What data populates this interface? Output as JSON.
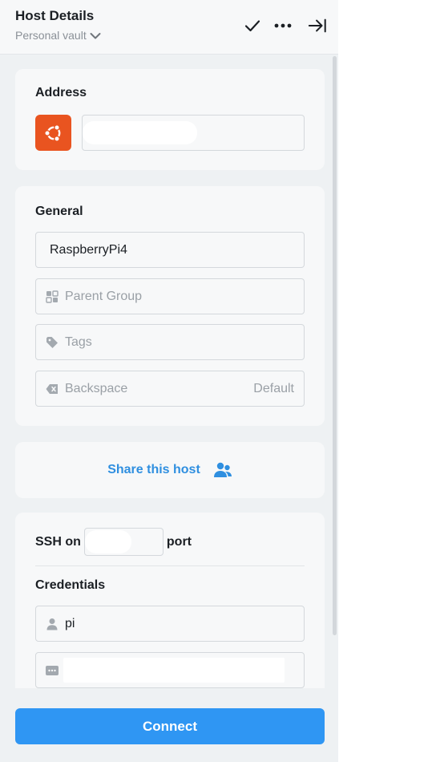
{
  "header": {
    "title": "Host Details",
    "vault": "Personal vault"
  },
  "address": {
    "title": "Address",
    "os_icon": "ubuntu-icon",
    "os_color": "#e95420",
    "value": ""
  },
  "general": {
    "title": "General",
    "label_value": "RaspberryPi4",
    "parent_group_placeholder": "Parent Group",
    "tags_placeholder": "Tags",
    "backspace_label": "Backspace",
    "backspace_value": "Default"
  },
  "share": {
    "label": "Share this host"
  },
  "connection": {
    "ssh_prefix": "SSH on",
    "port_value": "",
    "port_suffix": "port",
    "credentials_title": "Credentials",
    "username": "pi",
    "password": ""
  },
  "footer": {
    "connect_label": "Connect"
  },
  "colors": {
    "accent": "#2f96f3",
    "link": "#2f8fe0",
    "ubuntu": "#e95420"
  }
}
